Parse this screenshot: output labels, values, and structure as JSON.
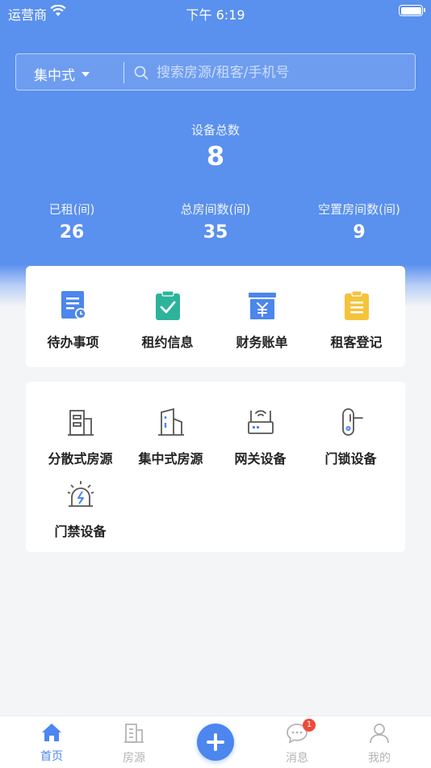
{
  "status_bar": {
    "carrier": "运营商",
    "time": "下午 6:19"
  },
  "search": {
    "type": "集中式",
    "placeholder": "搜索房源/租客/手机号"
  },
  "summary": {
    "total_label": "设备总数",
    "total_value": "8",
    "stats": [
      {
        "label": "已租(间)",
        "value": "26"
      },
      {
        "label": "总房间数(间)",
        "value": "35"
      },
      {
        "label": "空置房间数(间)",
        "value": "9"
      }
    ]
  },
  "quick_actions": [
    {
      "label": "待办事项",
      "icon": "todo-list-icon"
    },
    {
      "label": "租约信息",
      "icon": "lease-clipboard-icon"
    },
    {
      "label": "财务账单",
      "icon": "finance-bill-icon"
    },
    {
      "label": "租客登记",
      "icon": "tenant-register-icon"
    }
  ],
  "modules": [
    {
      "label": "分散式房源",
      "icon": "scattered-building-icon"
    },
    {
      "label": "集中式房源",
      "icon": "centralized-building-icon"
    },
    {
      "label": "网关设备",
      "icon": "gateway-router-icon"
    },
    {
      "label": "门锁设备",
      "icon": "door-lock-icon"
    },
    {
      "label": "门禁设备",
      "icon": "access-alarm-icon"
    }
  ],
  "tabbar": {
    "items": [
      {
        "label": "首页",
        "icon": "home-icon"
      },
      {
        "label": "房源",
        "icon": "building-icon"
      },
      {
        "label": "消息",
        "icon": "message-icon"
      },
      {
        "label": "我的",
        "icon": "user-icon"
      }
    ],
    "message_badge": "1"
  },
  "colors": {
    "primary": "#4c86ee",
    "hero": "#5a90ee",
    "teal": "#2db39b",
    "yellow": "#f5c33b",
    "badge": "#f04a3a"
  }
}
